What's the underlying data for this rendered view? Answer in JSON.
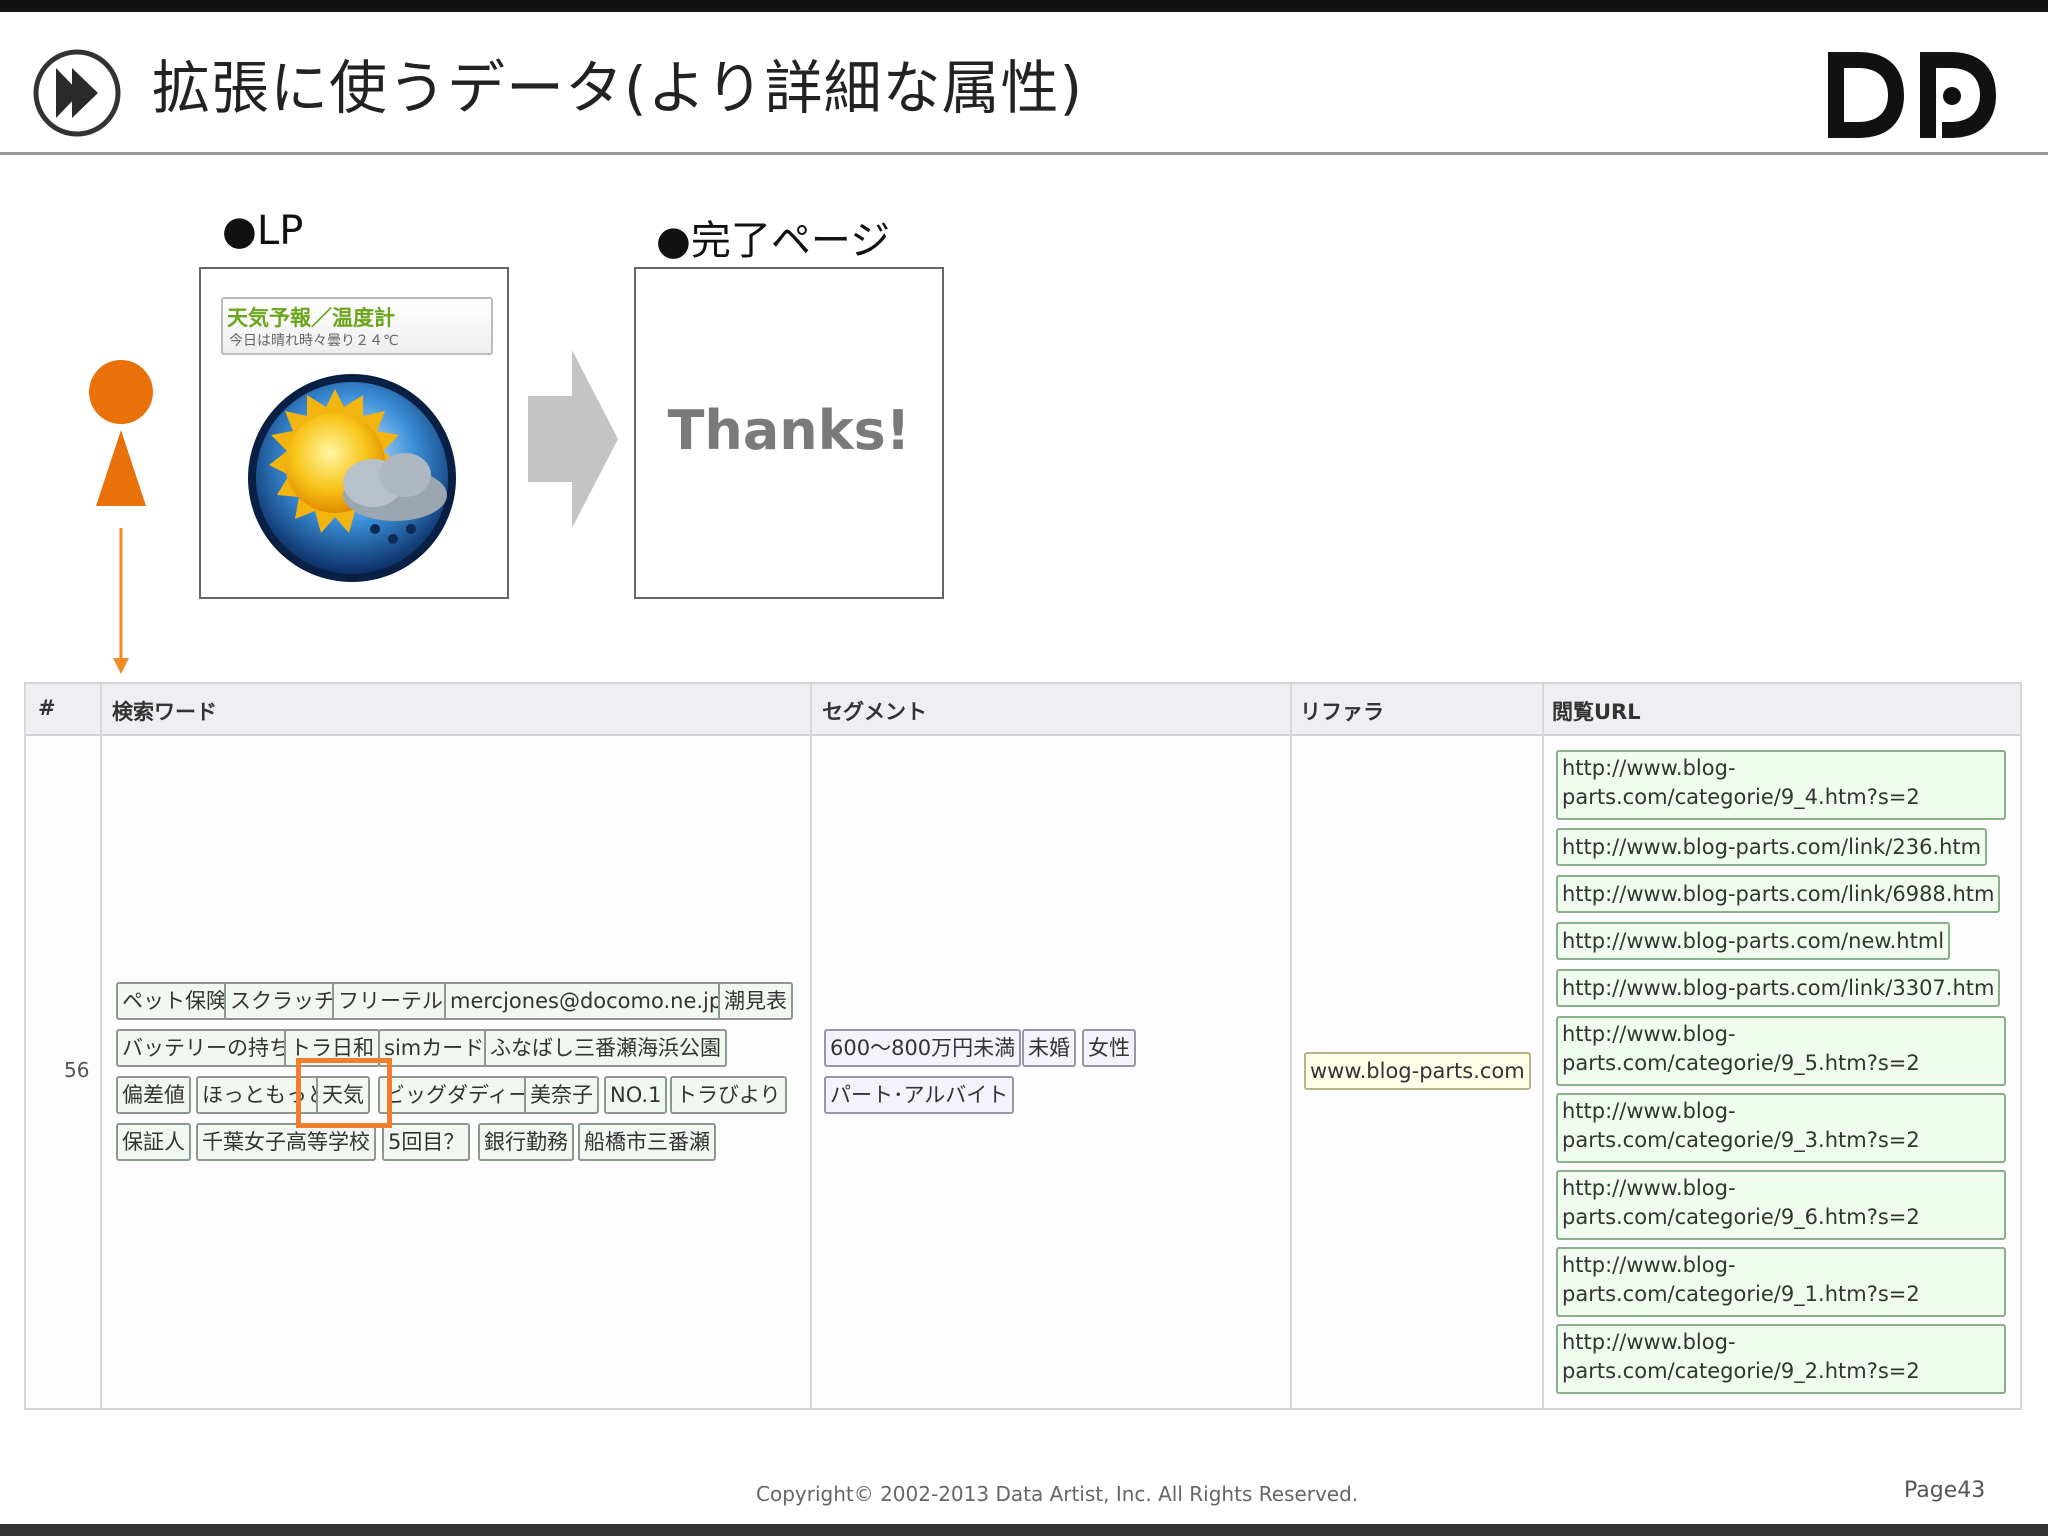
{
  "slide": {
    "title": "拡張に使うデータ(より詳細な属性)",
    "logo_text": "DD",
    "footer": "Copyright© 2002-2013 Data Artist, Inc.   All Rights Reserved.",
    "page_number": "Page43",
    "accent_color": "#ee7f2d"
  },
  "flow": {
    "lp_label": "●LP",
    "done_label": "●完了ページ",
    "lp_banner_title": "天気予報／温度計",
    "lp_banner_sub": "今日は晴れ時々曇り２４℃",
    "thanks_text": "Thanks!"
  },
  "table": {
    "headers": [
      "#",
      "検索ワード",
      "セグメント",
      "リファラ",
      "閲覧URL"
    ],
    "row_number": "56",
    "keywords": [
      "ペット保険",
      "スクラッチ",
      "フリーテル",
      "mercjones@docomo.ne.jp",
      "潮見表",
      "バッテリーの持ち",
      "トラ日和",
      "simカード",
      "ふなばし三番瀬海浜公園",
      "偏差値",
      "ほっともっと",
      "天気",
      "ビッグダディー",
      "美奈子",
      "NO.1",
      "トラびより",
      "保証人",
      "千葉女子高等学校",
      "5回目？",
      "銀行勤務",
      "船橋市三番瀬"
    ],
    "highlighted_keyword": "天気",
    "segments": [
      "600～800万円未満",
      "未婚",
      "女性",
      "パート･アルバイト"
    ],
    "referrer": "www.blog-parts.com",
    "urls": [
      "http://www.blog-parts.com/categorie/9_4.htm?s=2",
      "http://www.blog-parts.com/link/236.htm",
      "http://www.blog-parts.com/link/6988.htm",
      "http://www.blog-parts.com/new.html",
      "http://www.blog-parts.com/link/3307.htm",
      "http://www.blog-parts.com/categorie/9_5.htm?s=2",
      "http://www.blog-parts.com/categorie/9_3.htm?s=2",
      "http://www.blog-parts.com/categorie/9_6.htm?s=2",
      "http://www.blog-parts.com/categorie/9_1.htm?s=2",
      "http://www.blog-parts.com/categorie/9_2.htm?s=2"
    ]
  }
}
